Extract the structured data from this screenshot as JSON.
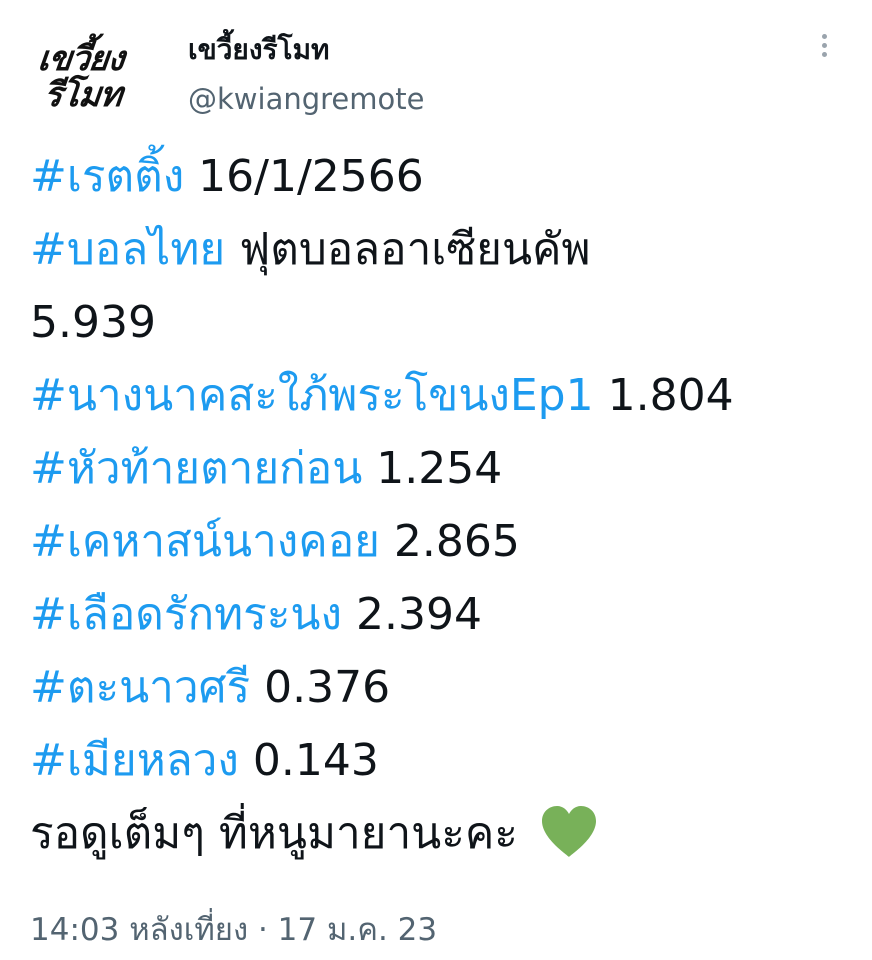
{
  "account": {
    "avatar_line1": "เขวี้ยง",
    "avatar_line2": "รีโมท",
    "display_name": "เขวี้ยงรีโมท",
    "handle": "@kwiangremote"
  },
  "tweet": {
    "lines": [
      {
        "tag": "#เรตติ้ง",
        "text": " 16/1/2566"
      },
      {
        "tag": "#บอลไทย",
        "text": " ฟุตบอลอาเซียนคัพ"
      },
      {
        "tag": "",
        "text": "5.939"
      },
      {
        "tag": "#นางนาคสะใภ้พระโขนงEp1",
        "text": " 1.804"
      },
      {
        "tag": "#หัวท้ายตายก่อน",
        "text": " 1.254"
      },
      {
        "tag": "#เคหาสน์นางคอย",
        "text": " 2.865"
      },
      {
        "tag": "#เลือดรักทระนง",
        "text": " 2.394"
      },
      {
        "tag": "#ตะนาวศรี",
        "text": " 0.376"
      },
      {
        "tag": "#เมียหลวง",
        "text": " 0.143"
      },
      {
        "tag": "",
        "text": "รอดูเต็มๆ ที่หนูมายานะคะ "
      }
    ],
    "timestamp": "14:03 หลังเที่ยง · 17 ม.ค. 23"
  },
  "icons": {
    "heart": "green-heart-icon",
    "more": "more-vertical-icon"
  },
  "colors": {
    "hashtag": "#1d9bf0",
    "text": "#0f1419",
    "secondary": "#536471",
    "heart": "#78b159"
  }
}
